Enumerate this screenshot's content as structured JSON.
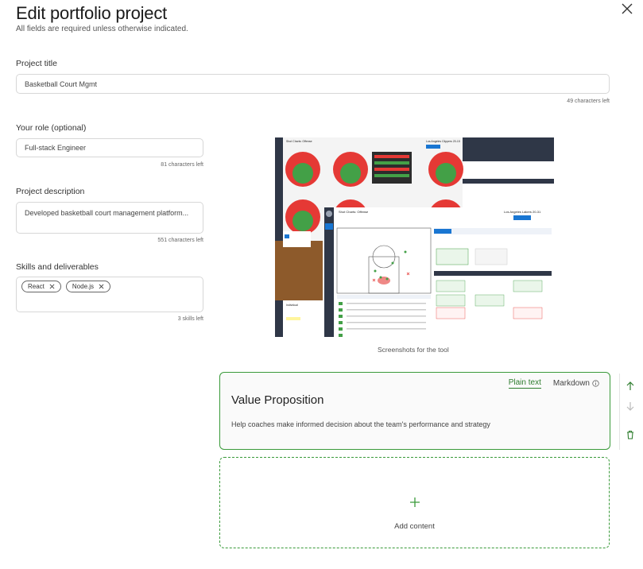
{
  "header": {
    "title": "Edit portfolio project",
    "subtitle": "All fields are required unless otherwise indicated."
  },
  "form": {
    "project_title": {
      "label": "Project title",
      "value": "Basketball Court Mgmt",
      "counter": "49 characters left"
    },
    "role": {
      "label": "Your role (optional)",
      "value": "Full-stack Engineer",
      "counter": "81 characters left"
    },
    "description": {
      "label": "Project description",
      "value": "Developed basketball court management platform...",
      "counter": "551 characters left"
    },
    "skills": {
      "label": "Skills and deliverables",
      "chips": [
        "React",
        "Node.js"
      ],
      "counter": "3 skills left"
    }
  },
  "media": {
    "caption": "Screenshots for the tool",
    "screenshot": {
      "back_title": "Shot Charts: Offense",
      "back_team": "Los Angeles Clippers 20-15",
      "front_title": "Shot Charts: Offense",
      "front_team": "Los Angeles Lakers 20-31",
      "panel_title": "Individual"
    }
  },
  "card": {
    "tab_plain": "Plain text",
    "tab_markdown": "Markdown",
    "title": "Value Proposition",
    "body": "Help coaches make informed decision about the team's performance and strategy"
  },
  "add_content": {
    "label": "Add content"
  },
  "colors": {
    "accent": "#3a9a3a",
    "shot_red": "#e53935",
    "shot_green": "#43a047",
    "nav_dark": "#2f3747"
  }
}
